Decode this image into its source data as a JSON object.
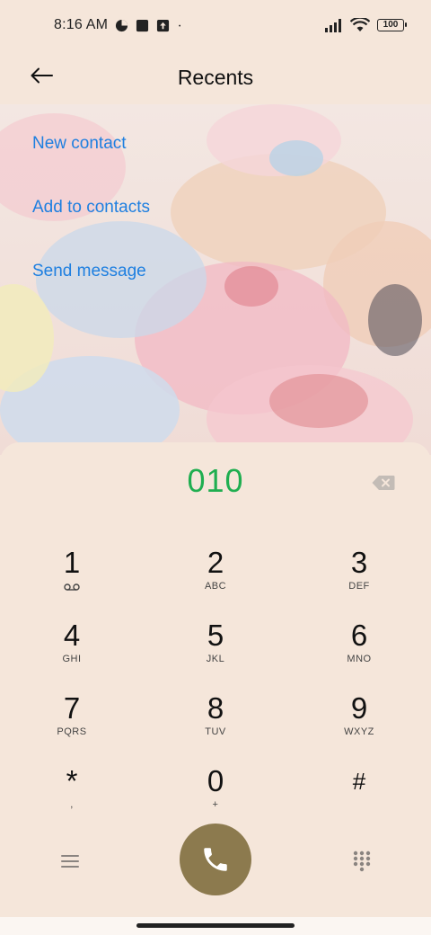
{
  "status_bar": {
    "time": "8:16 AM",
    "battery": "100",
    "icons": [
      "data-saver-icon",
      "notification-square-icon",
      "upload-icon",
      "dot-icon",
      "signal-icon",
      "wifi-icon",
      "battery-icon"
    ]
  },
  "header": {
    "title": "Recents",
    "back_icon": "back-arrow-icon"
  },
  "actions": [
    {
      "label": "New contact"
    },
    {
      "label": "Add to contacts"
    },
    {
      "label": "Send message"
    }
  ],
  "dialpad": {
    "number": "010",
    "keys": [
      {
        "digit": "1",
        "letters": "",
        "icon": "voicemail-icon"
      },
      {
        "digit": "2",
        "letters": "ABC"
      },
      {
        "digit": "3",
        "letters": "DEF"
      },
      {
        "digit": "4",
        "letters": "GHI"
      },
      {
        "digit": "5",
        "letters": "JKL"
      },
      {
        "digit": "6",
        "letters": "MNO"
      },
      {
        "digit": "7",
        "letters": "PQRS"
      },
      {
        "digit": "8",
        "letters": "TUV"
      },
      {
        "digit": "9",
        "letters": "WXYZ"
      },
      {
        "digit": "*",
        "letters": ","
      },
      {
        "digit": "0",
        "letters": "+"
      },
      {
        "digit": "#",
        "letters": ""
      }
    ]
  },
  "colors": {
    "accent_link": "#1e7fe0",
    "number_green": "#1fae50",
    "call_button": "#8c7a4e",
    "panel_bg": "#f5e6da"
  }
}
